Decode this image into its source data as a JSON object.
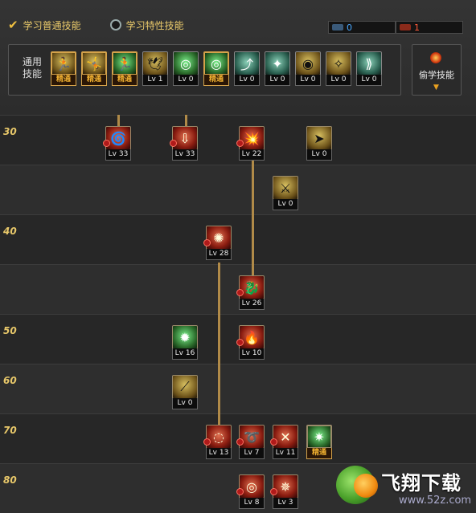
{
  "tabs": {
    "normal": "学习普通技能",
    "trait": "学习特性技能"
  },
  "counters": [
    {
      "value": "0",
      "color": "#4aa8ff"
    },
    {
      "value": "1",
      "color": "#ff5a3a"
    }
  ],
  "common_panel": {
    "label": "通用\n技能",
    "skills": [
      {
        "icon": "running-figure-icon",
        "level": "精通",
        "glyph": "🏃",
        "mastered": true,
        "theme": "gold"
      },
      {
        "icon": "kneeling-figure-icon",
        "level": "精通",
        "glyph": "🤸",
        "mastered": true,
        "theme": "gold"
      },
      {
        "icon": "sprint-figure-icon",
        "level": "精通",
        "glyph": "🏃",
        "mastered": true,
        "theme": "green"
      },
      {
        "icon": "wings-icon",
        "level": "Lv 1",
        "glyph": "🕊",
        "mastered": false,
        "theme": "gold"
      },
      {
        "icon": "target-icon",
        "level": "Lv 0",
        "glyph": "◎",
        "mastered": false,
        "theme": "green"
      },
      {
        "icon": "target-icon",
        "level": "精通",
        "glyph": "◎",
        "mastered": true,
        "theme": "green"
      },
      {
        "icon": "leap-figure-icon",
        "level": "Lv 0",
        "glyph": "⤴",
        "mastered": false,
        "theme": "teal"
      },
      {
        "icon": "crouch-figure-icon",
        "level": "Lv 0",
        "glyph": "✦",
        "mastered": false,
        "theme": "teal"
      },
      {
        "icon": "eye-orb-icon",
        "level": "Lv 0",
        "glyph": "◉",
        "mastered": false,
        "theme": "gold"
      },
      {
        "icon": "power-up-figure-icon",
        "level": "Lv 0",
        "glyph": "✧",
        "mastered": false,
        "theme": "gold"
      },
      {
        "icon": "dash-figure-icon",
        "level": "Lv 0",
        "glyph": "⟫",
        "mastered": false,
        "theme": "teal"
      }
    ]
  },
  "steal_skills": {
    "label": "偷学技能"
  },
  "tree": {
    "rows": [
      "30",
      "",
      "40",
      "",
      "50",
      "60",
      "70",
      "80"
    ],
    "skills": [
      {
        "icon": "spin-kick-icon",
        "level": "Lv 33",
        "glyph": "🌀",
        "theme": "red"
      },
      {
        "icon": "stomp-icon",
        "level": "Lv 33",
        "glyph": "⇩",
        "theme": "red"
      },
      {
        "icon": "blast-icon",
        "level": "Lv 22",
        "glyph": "💥",
        "theme": "red"
      },
      {
        "icon": "slide-icon",
        "level": "Lv 0",
        "glyph": "➤",
        "theme": "gold"
      },
      {
        "icon": "warrior-icon",
        "level": "Lv 0",
        "glyph": "⚔",
        "theme": "gold"
      },
      {
        "icon": "whirlwind-icon",
        "level": "Lv 28",
        "glyph": "✺",
        "theme": "red"
      },
      {
        "icon": "dragon-strike-icon",
        "level": "Lv 26",
        "glyph": "🐉",
        "theme": "red"
      },
      {
        "icon": "burst-icon",
        "level": "Lv 16",
        "glyph": "✹",
        "theme": "green"
      },
      {
        "icon": "flame-icon",
        "level": "Lv 10",
        "glyph": "🔥",
        "theme": "red"
      },
      {
        "icon": "slash-icon",
        "level": "Lv 0",
        "glyph": "⟋",
        "theme": "gold"
      },
      {
        "icon": "vortex-icon",
        "level": "Lv 13",
        "glyph": "◌",
        "theme": "red"
      },
      {
        "icon": "lasso-icon",
        "level": "Lv 7",
        "glyph": "➰",
        "theme": "red"
      },
      {
        "icon": "cross-strike-icon",
        "level": "Lv 11",
        "glyph": "✕",
        "theme": "red"
      },
      {
        "icon": "green-aura-icon",
        "level": "精通",
        "glyph": "✷",
        "theme": "green",
        "mastered": true
      },
      {
        "icon": "fire-ring-icon",
        "level": "Lv 8",
        "glyph": "◎",
        "theme": "red"
      },
      {
        "icon": "fire-figure-icon",
        "level": "Lv 3",
        "glyph": "✵",
        "theme": "red"
      }
    ]
  },
  "watermark": {
    "title": "飞翔下载",
    "url": "www.52z.com"
  }
}
